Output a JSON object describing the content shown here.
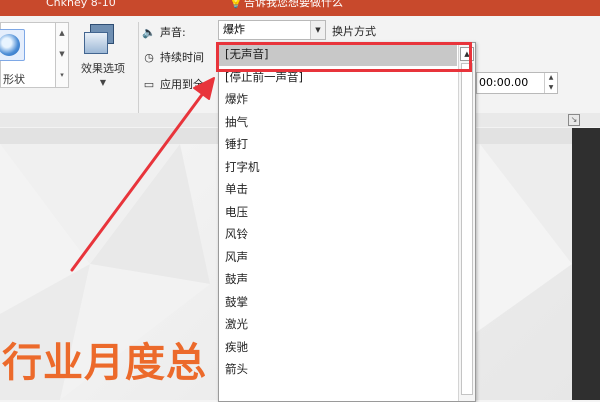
{
  "titlebar": {
    "text_left": "Chkney 8-10",
    "bulb_icon": "lightbulb-icon",
    "text_right": "告诉我您想要做什么"
  },
  "ribbon": {
    "gallery_label": "形状",
    "effect_options_label": "效果选项",
    "sound_label": "声音:",
    "sound_value": "爆炸",
    "switch_mode_label": "换片方式",
    "duration_label": "持续时间",
    "apply_all_label": "应用到全",
    "time_value": "00:00.00"
  },
  "dropdown": {
    "items": [
      "[无声音]",
      "[停止前一声音]",
      "爆炸",
      "抽气",
      "锤打",
      "打字机",
      "单击",
      "电压",
      "风铃",
      "风声",
      "鼓声",
      "鼓掌",
      "激光",
      "疾驰",
      "箭头"
    ],
    "selected_index": 0
  },
  "slide": {
    "title": "行业月度总"
  },
  "colors": {
    "titlebar": "#c8492c",
    "highlight": "#e8343b",
    "slide_title": "#ec6a2b"
  }
}
